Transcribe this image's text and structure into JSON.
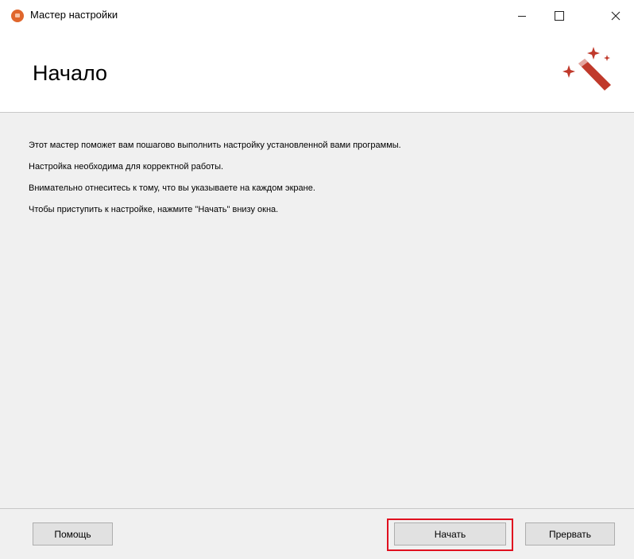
{
  "window": {
    "title": "Мастер настройки",
    "controls": [
      "minimize-icon",
      "maximize-icon",
      "close-icon"
    ]
  },
  "header": {
    "title": "Начало",
    "icon": "magic-wand-icon",
    "accent_color": "#c0392b"
  },
  "content": {
    "lines": [
      "Этот мастер поможет вам пошагово выполнить настройку установленной вами программы.",
      "Настройка необходима для корректной работы.",
      "Внимательно отнеситесь к тому, что вы указываете на каждом экране.",
      "Чтобы приступить к настройке, нажмите \"Начать\" внизу окна."
    ]
  },
  "footer": {
    "help_label": "Помощь",
    "start_label": "Начать",
    "cancel_label": "Прервать",
    "highlight_color": "#e0101f"
  }
}
